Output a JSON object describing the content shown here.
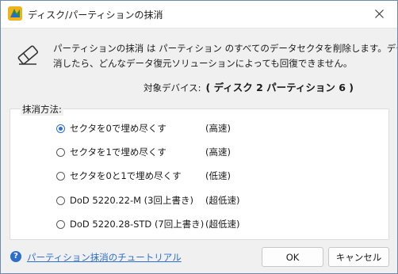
{
  "window": {
    "title": "ディスク/パーティションの抹消",
    "icon": "minitool-app-icon",
    "close_icon": "close-icon"
  },
  "description": {
    "line1": "パーティションの抹消 は パーティション のすべてのデータセクタを削除します。データを一旦抹",
    "line2": "消したら、どんなデータ復元ソリューションによっても回復できません。",
    "icon": "eraser-icon"
  },
  "target": {
    "label": "対象デバイス:",
    "value": "( ディスク 2 パーティション 6 )"
  },
  "method_group": {
    "label": "抹消方法:",
    "options": [
      {
        "label": "セクタを0で埋め尽くす",
        "speed": "(高速)",
        "selected": true
      },
      {
        "label": "セクタを1で埋め尽くす",
        "speed": "(高速)",
        "selected": false
      },
      {
        "label": "セクタを0と1で埋め尽くす",
        "speed": "(低速)",
        "selected": false
      },
      {
        "label": "DoD 5220.22-M (3回上書き)",
        "speed": "(超低速)",
        "selected": false
      },
      {
        "label": "DoD 5220.28-STD (7回上書き)",
        "speed": "(超低速)",
        "selected": false
      }
    ]
  },
  "footer": {
    "help_icon_text": "?",
    "help_link": "パーティション抹消のチュートリアル",
    "ok_label": "OK",
    "cancel_label": "キャンセル"
  },
  "colors": {
    "accent": "#2c6fcc",
    "dialog_bg": "#f0f0f0",
    "border": "#6c8ab0"
  }
}
